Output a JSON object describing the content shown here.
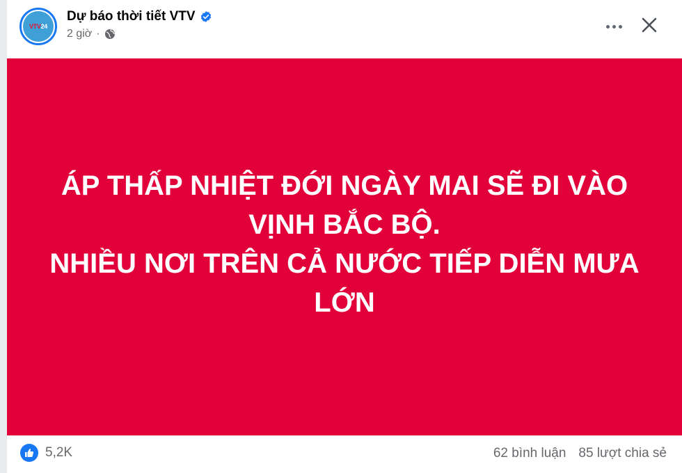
{
  "post": {
    "page_name": "Dự báo thời tiết VTV",
    "time_ago": "2 giờ",
    "separator": "·",
    "avatar": {
      "logo_text_a": "VTV",
      "logo_text_b": "24"
    }
  },
  "banner": {
    "background_color": "#e1003a",
    "lines": [
      "ÁP THẤP NHIỆT ĐỚI NGÀY MAI SẼ ĐI VÀO",
      "VỊNH BẮC BỘ.",
      "NHIỀU NƠI TRÊN CẢ NƯỚC TIẾP DIỄN MƯA",
      "LỚN"
    ]
  },
  "footer": {
    "reactions_count": "5,2K",
    "comments": "62 bình luận",
    "shares": "85 lượt chia sẻ"
  },
  "icons": {
    "verified": "verified-badge-icon",
    "privacy": "globe-icon",
    "more": "more-options-icon",
    "close": "close-icon",
    "like": "like-icon"
  },
  "colors": {
    "accent": "#1877f2",
    "secondary_text": "#65676b"
  }
}
